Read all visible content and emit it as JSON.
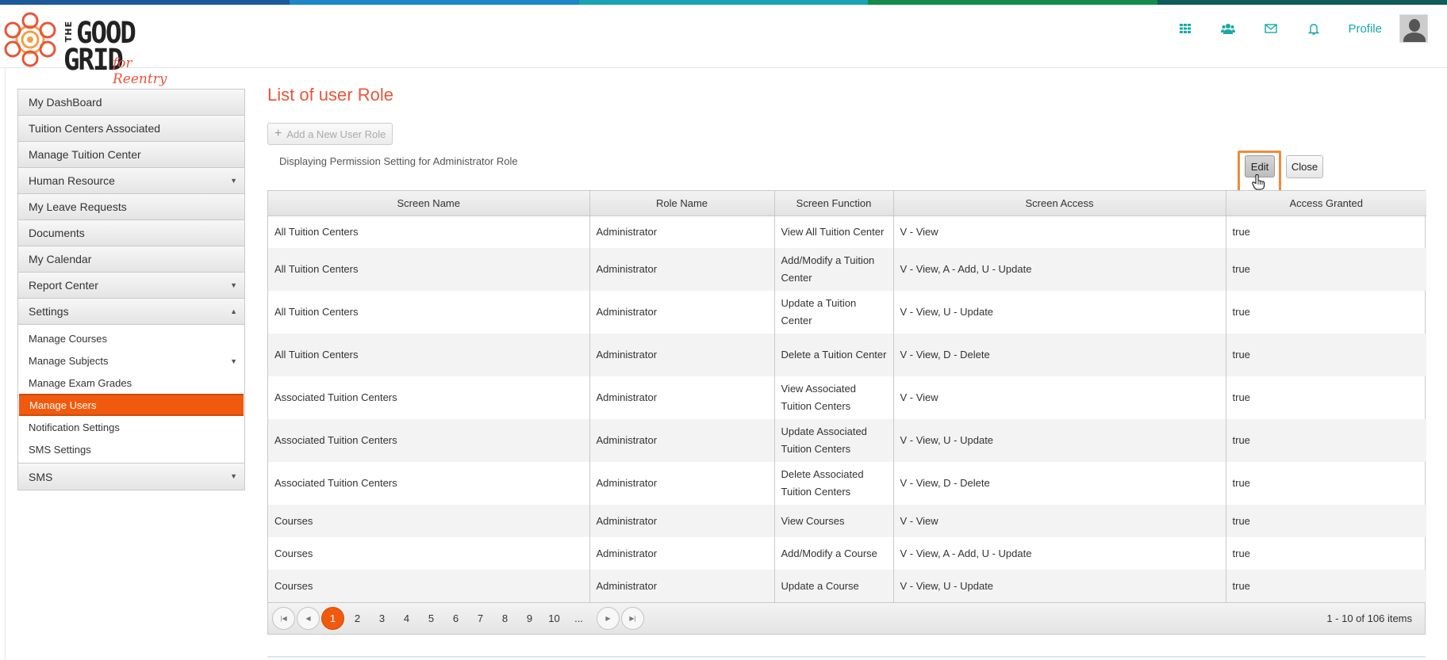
{
  "brand": {
    "logo_the": "THE",
    "logo_good": "GOOD",
    "logo_grid": "GRID",
    "logo_sub": "for Reentry",
    "colors": {
      "accent": "#e8553a",
      "active": "#f15a0e",
      "link": "#17a8a8"
    }
  },
  "topbar": {
    "icons": [
      "grid-icon",
      "users-icon",
      "mail-icon",
      "bell-icon"
    ],
    "profile_label": "Profile"
  },
  "sidebar": {
    "items": [
      {
        "label": "My DashBoard"
      },
      {
        "label": "Tuition Centers Associated"
      },
      {
        "label": "Manage Tuition Center"
      },
      {
        "label": "Human Resource"
      },
      {
        "label": "My Leave Requests"
      },
      {
        "label": "Documents"
      },
      {
        "label": "My Calendar"
      },
      {
        "label": "Report Center"
      },
      {
        "label": "Settings"
      },
      {
        "label": "SMS"
      }
    ],
    "settings_sub": [
      {
        "label": "Manage Courses"
      },
      {
        "label": "Manage Subjects"
      },
      {
        "label": "Manage Exam Grades"
      },
      {
        "label": "Manage Users"
      },
      {
        "label": "Notification Settings"
      },
      {
        "label": "SMS Settings"
      }
    ]
  },
  "main": {
    "title": "List of user Role",
    "add_button": "Add a New User Role",
    "caption": "Displaying Permission Setting for Administrator Role",
    "edit_button": "Edit",
    "close_button": "Close"
  },
  "table": {
    "columns": [
      "Screen Name",
      "Role Name",
      "Screen Function",
      "Screen Access",
      "Access Granted"
    ],
    "rows": [
      [
        "All Tuition Centers",
        "Administrator",
        "View All Tuition Center",
        "V - View",
        "true"
      ],
      [
        "All Tuition Centers",
        "Administrator",
        "Add/Modify a Tuition Center",
        "V - View, A - Add, U - Update",
        "true"
      ],
      [
        "All Tuition Centers",
        "Administrator",
        "Update a Tuition Center",
        "V - View, U - Update",
        "true"
      ],
      [
        "All Tuition Centers",
        "Administrator",
        "Delete a Tuition Center",
        "V - View, D - Delete",
        "true"
      ],
      [
        "Associated Tuition Centers",
        "Administrator",
        "View Associated Tuition Centers",
        "V - View",
        "true"
      ],
      [
        "Associated Tuition Centers",
        "Administrator",
        "Update Associated Tuition Centers",
        "V - View, U - Update",
        "true"
      ],
      [
        "Associated Tuition Centers",
        "Administrator",
        "Delete Associated Tuition Centers",
        "V - View, D - Delete",
        "true"
      ],
      [
        "Courses",
        "Administrator",
        "View Courses",
        "V - View",
        "true"
      ],
      [
        "Courses",
        "Administrator",
        "Add/Modify a Course",
        "V - View, A - Add, U - Update",
        "true"
      ],
      [
        "Courses",
        "Administrator",
        "Update a Course",
        "V - View, U - Update",
        "true"
      ]
    ]
  },
  "pager": {
    "pages": [
      "1",
      "2",
      "3",
      "4",
      "5",
      "6",
      "7",
      "8",
      "9",
      "10",
      "..."
    ],
    "current": "1",
    "info": "1 - 10 of 106 items"
  }
}
